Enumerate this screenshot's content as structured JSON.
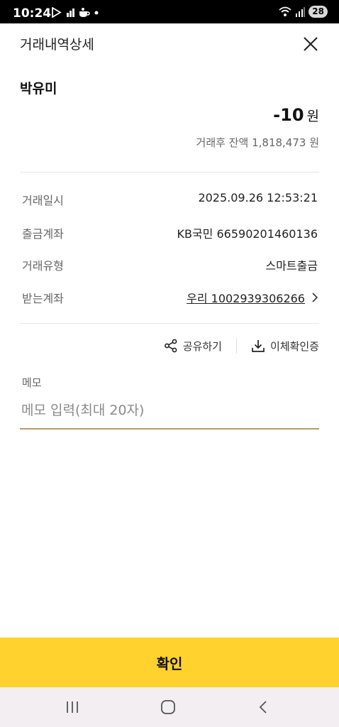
{
  "status_bar": {
    "time": "10:24",
    "battery": "28",
    "icons": [
      "play-store-icon",
      "notification-icon",
      "coffee-icon",
      "dot-icon",
      "wifi-icon",
      "signal-icon",
      "battery-icon"
    ]
  },
  "header": {
    "title": "거래내역상세",
    "close_icon": "close-icon"
  },
  "transaction": {
    "name": "박유미",
    "amount": "-10",
    "amount_unit": "원",
    "balance": "거래후 잔액 1,818,473 원"
  },
  "details": [
    {
      "label": "거래일시",
      "value": "2025.09.26 12:53:21"
    },
    {
      "label": "출금계좌",
      "value": "KB국민 66590201460136"
    },
    {
      "label": "거래유형",
      "value": "스마트출금"
    },
    {
      "label": "받는계좌",
      "value": "우리 1002939306266"
    }
  ],
  "actions": {
    "share_label": "공유하기",
    "certificate_label": "이체확인증"
  },
  "memo": {
    "label": "메모",
    "placeholder": "메모 입력(최대 20자)",
    "value": ""
  },
  "confirm_label": "확인",
  "colors": {
    "accent": "#ffd22e",
    "memo_underline": "#b49c6c",
    "status_bar": "#000000"
  }
}
